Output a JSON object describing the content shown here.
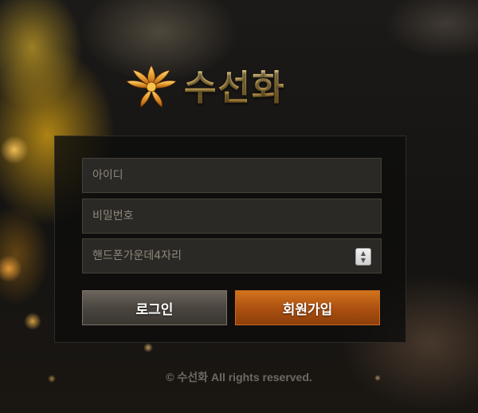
{
  "logo": {
    "emblem_icon": "lotus-flower-icon",
    "title": "수선화"
  },
  "login_form": {
    "id_placeholder": "아이디",
    "id_value": "",
    "password_placeholder": "비밀번호",
    "password_value": "",
    "phone_digits_placeholder": "핸드폰가운데4자리",
    "phone_digits_value": "",
    "spinner_icon": "up-down-spinner-icon",
    "login_label": "로그인",
    "signup_label": "회원가입"
  },
  "footer": {
    "copyright": "© 수선화 All rights reserved."
  },
  "colors": {
    "accent_orange": "#b85a14",
    "logo_gold": "#e8c16a",
    "panel_bg": "#0e0d0c",
    "field_bg": "#2b2925"
  }
}
